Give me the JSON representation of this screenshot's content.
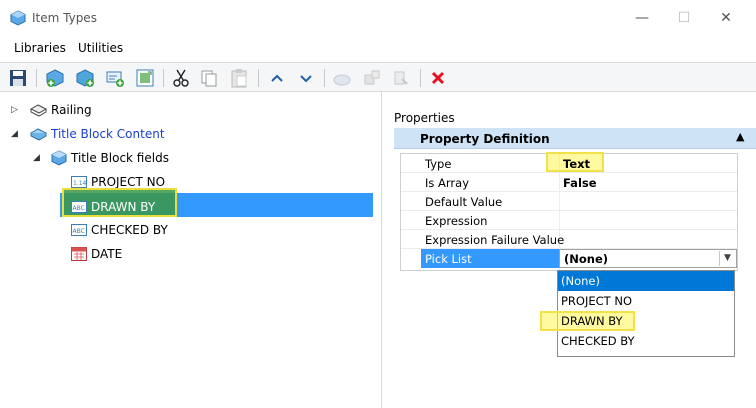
{
  "window": {
    "title": "Item Types",
    "minimize": "—",
    "maximize": "☐",
    "close": "✕"
  },
  "menu": {
    "items": [
      "Libraries",
      "Utilities"
    ]
  },
  "toolbar": {
    "icons": [
      "save-icon",
      "add-library-icon",
      "add-item-type-icon",
      "add-property-icon",
      "import-icon",
      "cut-icon",
      "copy-icon",
      "paste-icon",
      "move-up-icon",
      "move-down-icon",
      "disabled-icon-1",
      "disabled-icon-2",
      "disabled-icon-3",
      "delete-icon"
    ]
  },
  "tree": {
    "railing": "Railing",
    "title_block_content": "Title Block Content",
    "title_block_fields": "Title Block fields",
    "fields": [
      {
        "label": "PROJECT NO",
        "badge": "1.14"
      },
      {
        "label": "DRAWN BY",
        "badge": "ABC"
      },
      {
        "label": "CHECKED BY",
        "badge": "ABC"
      },
      {
        "label": "DATE",
        "badge": ""
      }
    ]
  },
  "properties": {
    "label": "Properties",
    "section_title": "Property Definition",
    "rows": [
      {
        "name": "Type",
        "value": "Text"
      },
      {
        "name": "Is Array",
        "value": "False"
      },
      {
        "name": "Default Value",
        "value": ""
      },
      {
        "name": "Expression",
        "value": ""
      },
      {
        "name": "Expression Failure Value",
        "value": ""
      },
      {
        "name": "Pick List",
        "value": "(None)"
      }
    ],
    "picklist_options": [
      "(None)",
      "PROJECT NO",
      "DRAWN BY",
      "CHECKED BY"
    ]
  },
  "colors": {
    "selection": "#3399ff",
    "highlight": "#f1e24a",
    "header": "#cfe3f6",
    "delete": "#e81123"
  }
}
